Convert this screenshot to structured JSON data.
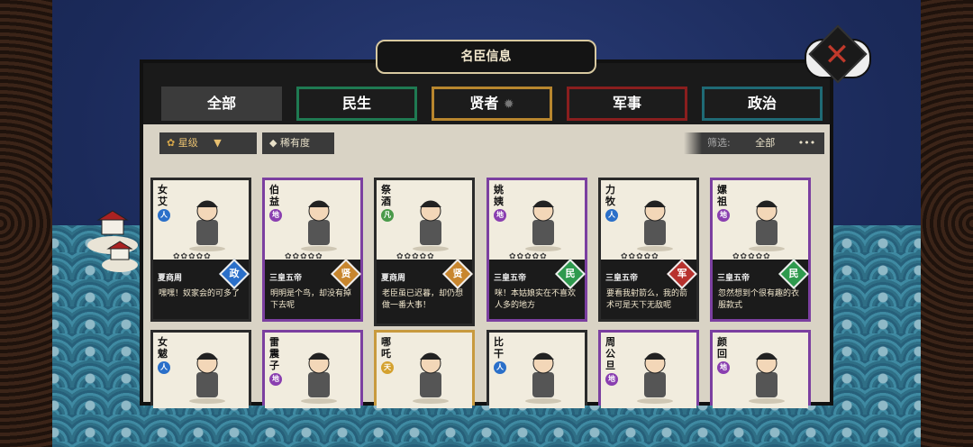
{
  "title": "名臣信息",
  "close_icon": "close-x-icon",
  "tabs": [
    {
      "label": "全部",
      "border": "#3b3b3b",
      "active": true
    },
    {
      "label": "民生",
      "border": "#1f7a52",
      "active": false
    },
    {
      "label": "贤者",
      "border": "#b8862e",
      "active": false
    },
    {
      "label": "军事",
      "border": "#8a1e1e",
      "active": false
    },
    {
      "label": "政治",
      "border": "#1f6a75",
      "active": false
    }
  ],
  "sort": {
    "star_label": "星级",
    "rarity_label": "稀有度"
  },
  "filter": {
    "label": "筛选:",
    "value": "全部",
    "more": "•••"
  },
  "cards": [
    {
      "name": "女艾",
      "tag": "人",
      "tag_color": "#2a6fc9",
      "rarity": "plain",
      "stars": "✿✿✿✿✿",
      "era": "夏商周",
      "cat": "政",
      "cat_color": "#2a6fc9",
      "desc": "嘿嘿！奴家会的可多了"
    },
    {
      "name": "伯益",
      "tag": "地",
      "tag_color": "#8a3fb0",
      "rarity": "purple",
      "stars": "✿✿✿✿✿",
      "era": "三皇五帝",
      "cat": "贤",
      "cat_color": "#c8862e",
      "desc": "明明是个鸟，却没有掉下去呢"
    },
    {
      "name": "祭酒",
      "tag": "凡",
      "tag_color": "#4a9a4a",
      "rarity": "plain",
      "stars": "✿✿✿✿✿",
      "era": "夏商周",
      "cat": "贤",
      "cat_color": "#c8862e",
      "desc": "老臣虽已迟暮，却仍想做一番大事！"
    },
    {
      "name": "姚姨",
      "tag": "地",
      "tag_color": "#8a3fb0",
      "rarity": "purple",
      "stars": "✿✿✿✿✿",
      "era": "三皇五帝",
      "cat": "民",
      "cat_color": "#2e9a4e",
      "desc": "咪！本姑娘实在不喜欢人多的地方"
    },
    {
      "name": "力牧",
      "tag": "人",
      "tag_color": "#2a6fc9",
      "rarity": "plain",
      "stars": "✿✿✿✿✿",
      "era": "三皇五帝",
      "cat": "军",
      "cat_color": "#b8322e",
      "desc": "要看我射箭么，我的箭术可是天下无敌呢"
    },
    {
      "name": "嫘祖",
      "tag": "地",
      "tag_color": "#8a3fb0",
      "rarity": "purple",
      "stars": "✿✿✿✿✿",
      "era": "三皇五帝",
      "cat": "民",
      "cat_color": "#2e9a4e",
      "desc": "忽然想到个很有趣的衣服款式"
    },
    {
      "name": "女魃",
      "tag": "人",
      "tag_color": "#2a6fc9",
      "rarity": "plain"
    },
    {
      "name": "雷震子",
      "tag": "地",
      "tag_color": "#8a3fb0",
      "rarity": "purple"
    },
    {
      "name": "哪吒",
      "tag": "天",
      "tag_color": "#d4a12e",
      "rarity": "gold"
    },
    {
      "name": "比干",
      "tag": "人",
      "tag_color": "#2a6fc9",
      "rarity": "plain"
    },
    {
      "name": "周公旦",
      "tag": "地",
      "tag_color": "#8a3fb0",
      "rarity": "purple"
    },
    {
      "name": "颜回",
      "tag": "地",
      "tag_color": "#8a3fb0",
      "rarity": "purple"
    }
  ]
}
